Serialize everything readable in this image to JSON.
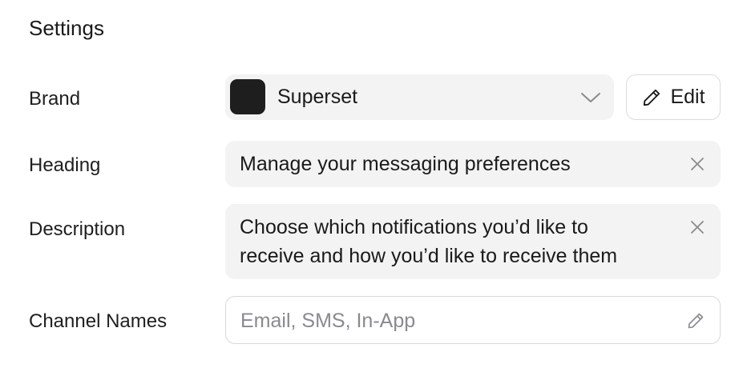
{
  "settings": {
    "title": "Settings"
  },
  "brand": {
    "label": "Brand",
    "value": "Superset",
    "swatch_color": "#1e1e1e",
    "dropdown_icon": "chevron-down-icon",
    "edit_label": "Edit",
    "edit_icon": "pencil-icon"
  },
  "heading": {
    "label": "Heading",
    "value": "Manage your messaging preferences",
    "clear_icon": "close-icon"
  },
  "description": {
    "label": "Description",
    "line1": "Choose which notifications you’d like to",
    "line2": "receive and how you’d like to receive them",
    "clear_icon": "close-icon"
  },
  "channel_names": {
    "label": "Channel Names",
    "placeholder": "Email, SMS, In-App",
    "edit_icon": "pencil-icon"
  }
}
